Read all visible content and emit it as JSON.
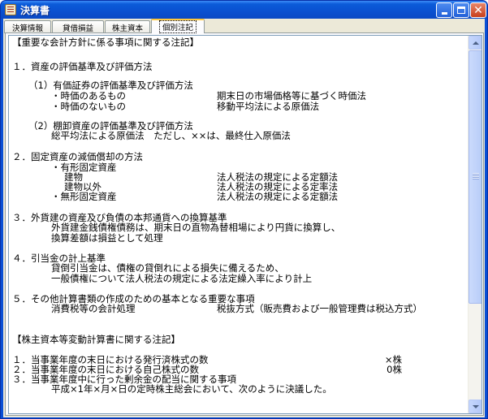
{
  "window": {
    "title": "決算書"
  },
  "tabs": [
    {
      "label": "決算情報"
    },
    {
      "label": "貸借損益"
    },
    {
      "label": "株主資本"
    },
    {
      "label": "個別注記"
    }
  ],
  "notes": {
    "header": "【重要な会計方針に係る事項に関する注記】",
    "s1_title": "１．資産の評価基準及び評価方法",
    "s1_1_title": "（1）有価証券の評価基準及び評価方法",
    "s1_1_a_label": "・時価のあるもの",
    "s1_1_a_value": "期末日の市場価格等に基づく時価法",
    "s1_1_b_label": "・時価のないもの",
    "s1_1_b_value": "移動平均法による原価法",
    "s1_2_title": "（2）棚卸資産の評価基準及び評価方法",
    "s1_2_body": "総平均法による原価法　ただし、××は、最終仕入原価法",
    "s2_title": "２．固定資産の減価償却の方法",
    "s2_a": "・有形固定資産",
    "s2_a1_label": "建物",
    "s2_a1_value": "法人税法の規定による定額法",
    "s2_a2_label": "建物以外",
    "s2_a2_value": "法人税法の規定による定率法",
    "s2_b_label": "・無形固定資産",
    "s2_b_value": "法人税法の規定による定額法",
    "s3_title": "３．外貨建の資産及び負債の本邦通貨への換算基準",
    "s3_l1": "外貨建金銭債権債務は、期末日の直物為替相場により円貨に換算し、",
    "s3_l2": "換算差額は損益として処理",
    "s4_title": "４．引当金の計上基準",
    "s4_l1": "貸倒引当金は、債権の貸倒れによる損失に備えるため、",
    "s4_l2": "一般債権について法人税法の規定による法定繰入率により計上",
    "s5_title": "５．その他計算書類の作成のための基本となる重要な事項",
    "s5_label": "消費税等の会計処理",
    "s5_value": "税抜方式（販売費および一般管理費は税込方式）",
    "equity_header": "【株主資本等変動計算書に関する注記】",
    "e1_label": "１．当事業年度の末日における発行済株式の数",
    "e1_value": "×株",
    "e2_label": "２．当事業年度の末日における自己株式の数",
    "e2_value": "0株",
    "e3_label": "３．当事業年度中に行った剰余金の配当に関する事項",
    "e3_body": "平成×1年×月×日の定時株主総会において、次のように決議した。"
  },
  "icons": {
    "app": "ledger-document-icon",
    "minimize": "minimize-icon",
    "maximize": "maximize-icon",
    "close": "close-icon"
  },
  "colors": {
    "titlebar": "#0a50d0",
    "close_button": "#c8401c",
    "active_tab_highlight": "#ffc83c",
    "client_background": "#ece9d8"
  }
}
